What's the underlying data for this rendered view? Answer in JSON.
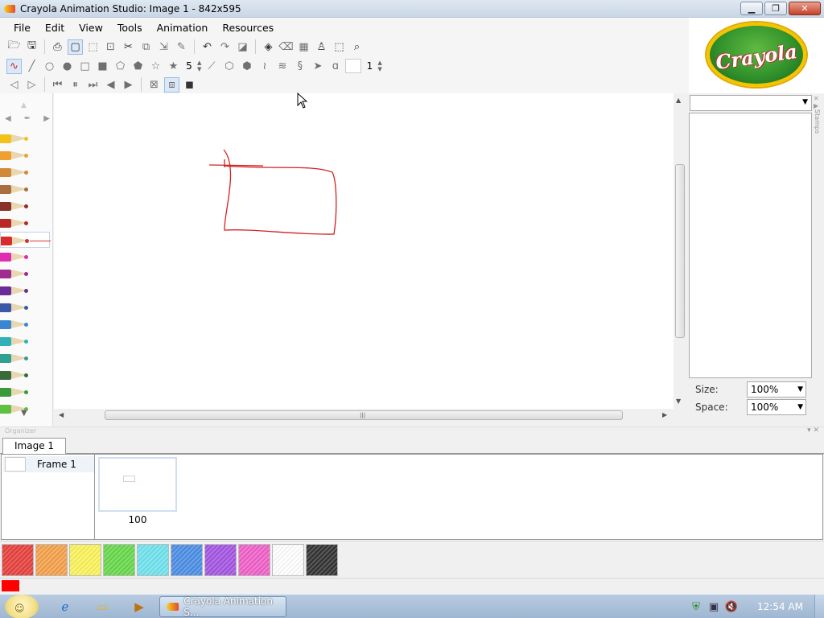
{
  "window": {
    "title": "Crayola Animation Studio: Image 1 - 842x595",
    "minimize_glyph": "▁",
    "maximize_glyph": "❐",
    "close_glyph": "✕"
  },
  "menu": {
    "file": "File",
    "edit": "Edit",
    "view": "View",
    "tools": "Tools",
    "animation": "Animation",
    "resources": "Resources"
  },
  "toolbar": {
    "brush_size": "5",
    "frame_number": "1"
  },
  "logo": {
    "text": "Crayola"
  },
  "right_panel": {
    "size_label": "Size:",
    "size_value": "100%",
    "space_label": "Space:",
    "space_value": "100%",
    "side_label": "Stamps"
  },
  "organizer": {
    "label": "Organizer",
    "tab": "Image 1",
    "frame_label": "Frame 1",
    "thumb_label": "100"
  },
  "palette": {
    "colors": [
      "#e8403c",
      "#f5a14a",
      "#fbf35a",
      "#67d94a",
      "#6fe3ee",
      "#4b8ee6",
      "#a454e3",
      "#f060c9",
      "#ffffff",
      "#333333"
    ]
  },
  "status": {
    "current_color": "#ff0000"
  },
  "crayons": {
    "colors": [
      "#f2c21a",
      "#f0a030",
      "#d08a3a",
      "#a87040",
      "#8a3028",
      "#b82828",
      "#d82c2c",
      "#e02cb0",
      "#a02c90",
      "#6a2c98",
      "#3a5aa8",
      "#3a86d0",
      "#30b0b8",
      "#30a090",
      "#3a6a3a",
      "#3a9a3a",
      "#60c040"
    ],
    "selected_index": 6
  },
  "taskbar": {
    "task_label": "Crayola Animation S...",
    "clock": "12:54 AM"
  },
  "drawing": {
    "stroke_color": "#d42020"
  }
}
